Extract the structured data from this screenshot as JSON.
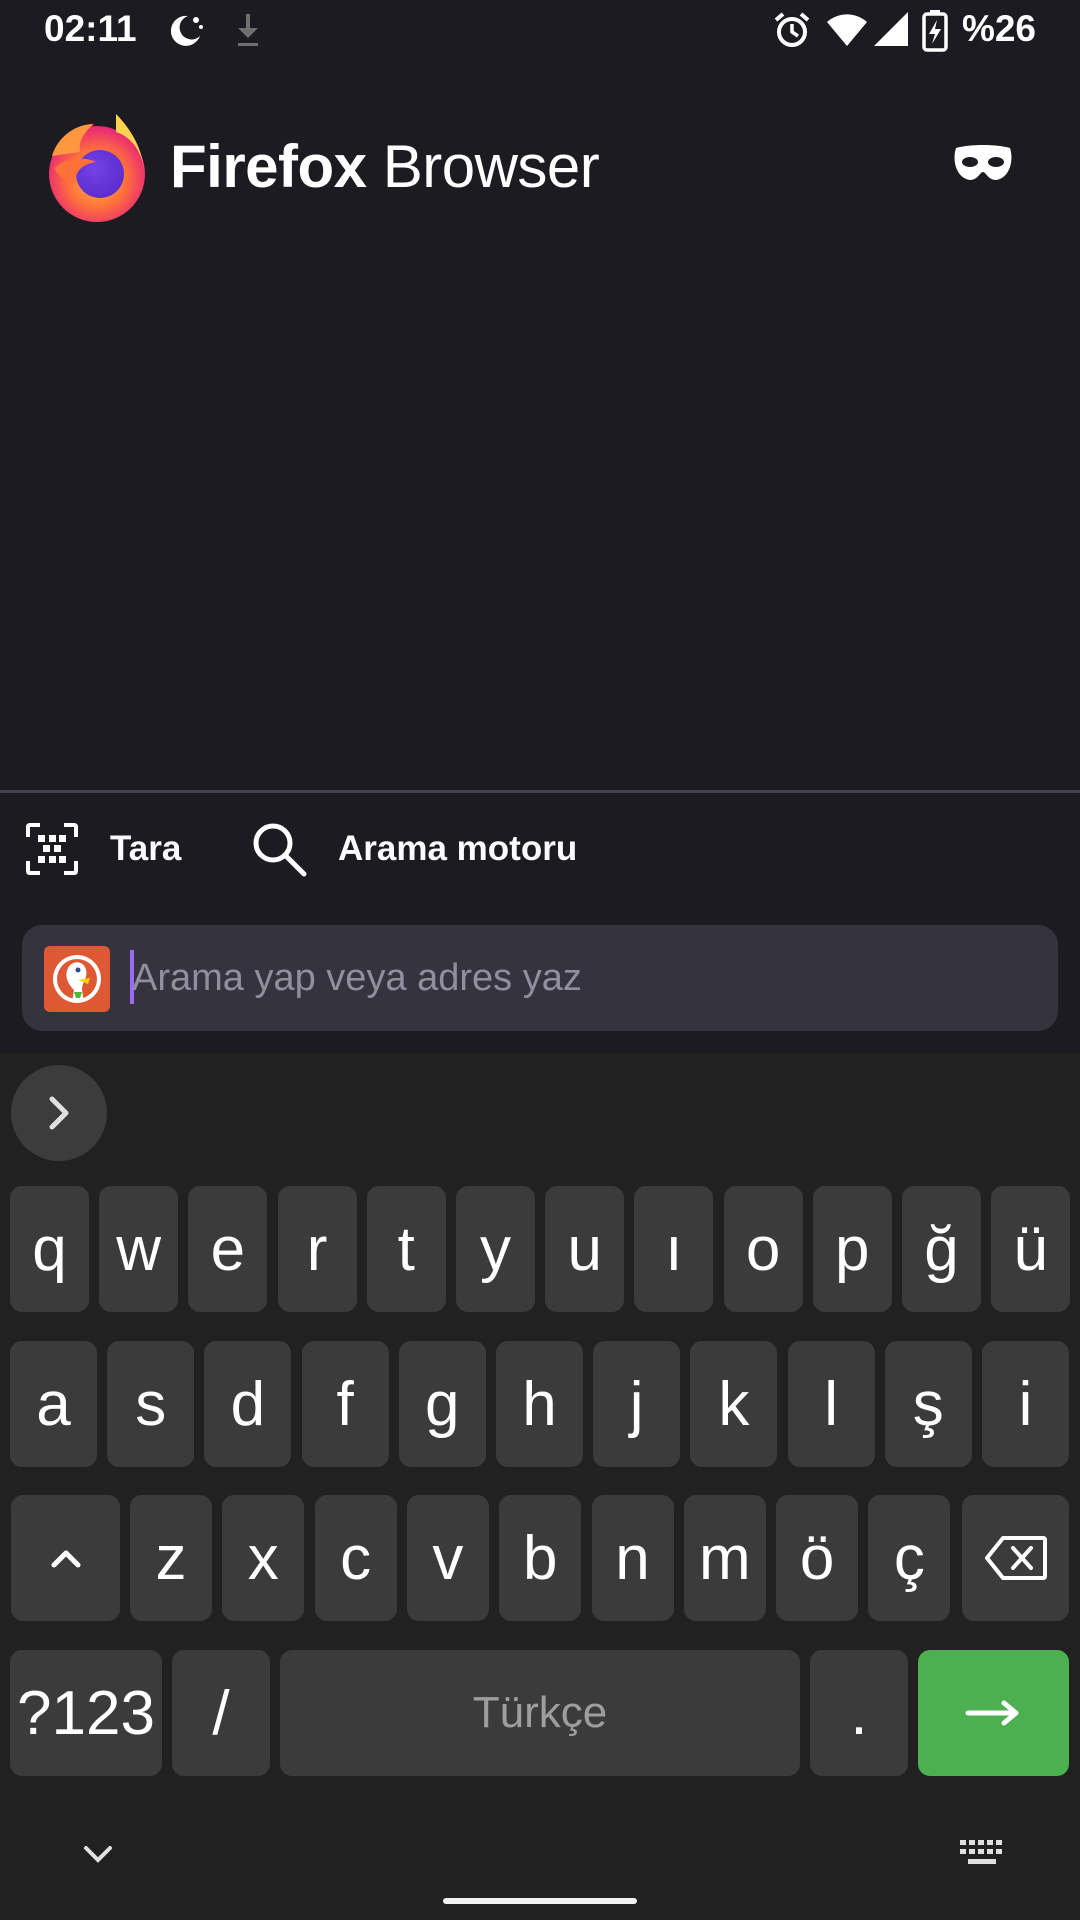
{
  "status_bar": {
    "time": "02:11",
    "battery_percent": "%26",
    "icons": [
      "do-not-disturb-moon-icon",
      "download-icon",
      "alarm-icon",
      "wifi-icon",
      "signal-icon",
      "battery-charging-icon"
    ]
  },
  "header": {
    "app_name_bold": "Firefox",
    "app_name_light": " Browser",
    "logo_icon": "firefox-logo",
    "private_icon": "private-browsing-mask-icon"
  },
  "toolbar": {
    "scan_label": "Tara",
    "search_engine_label": "Arama motoru",
    "scan_icon": "qr-scan-icon",
    "search_icon": "search-icon"
  },
  "url_bar": {
    "placeholder": "Arama yap veya adres yaz",
    "value": "",
    "engine_icon": "duckduckgo-icon"
  },
  "keyboard": {
    "row1": [
      "q",
      "w",
      "e",
      "r",
      "t",
      "y",
      "u",
      "ı",
      "o",
      "p",
      "ğ",
      "ü"
    ],
    "row2": [
      "a",
      "s",
      "d",
      "f",
      "g",
      "h",
      "j",
      "k",
      "l",
      "ş",
      "i"
    ],
    "row3": [
      "z",
      "x",
      "c",
      "v",
      "b",
      "n",
      "m",
      "ö",
      "ç"
    ],
    "symbols_label": "?123",
    "slash_label": "/",
    "space_label": "Türkçe",
    "period_label": ".",
    "enter_color": "#4caf50"
  },
  "colors": {
    "background": "#1c1b22",
    "url_bar": "#34333e",
    "cursor": "#9a6bf0",
    "keyboard_bg": "#212121",
    "key_bg": "#3b3b3b"
  }
}
